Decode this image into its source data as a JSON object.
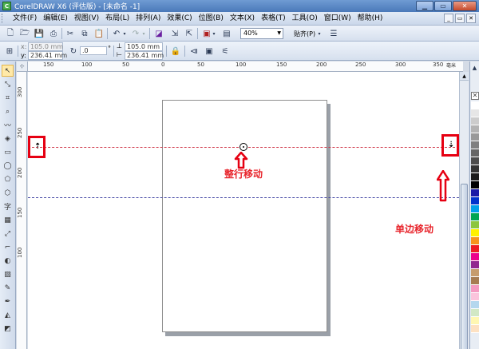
{
  "window": {
    "title": "CorelDRAW X6 (评估版) - [未命名 -1]",
    "app_icon": "coreldraw-icon",
    "controls": [
      "minimize",
      "maximize",
      "close"
    ]
  },
  "menu": {
    "items": [
      "文件(F)",
      "编辑(E)",
      "视图(V)",
      "布局(L)",
      "排列(A)",
      "效果(C)",
      "位图(B)",
      "文本(X)",
      "表格(T)",
      "工具(O)",
      "窗口(W)",
      "帮助(H)"
    ]
  },
  "standard_toolbar": {
    "zoom_value": "40%",
    "snap_label": "贴齐(P)"
  },
  "property_bar": {
    "x_label": "x:",
    "x_value": "105.0 mm",
    "y_label": "y:",
    "y_value": "236.41 mm",
    "angle_value": ".0",
    "pos_x_value": "105.0 mm",
    "pos_y_value": "236.41 mm"
  },
  "rulers": {
    "horizontal_ticks": [
      "150",
      "100",
      "50",
      "0",
      "50",
      "100",
      "150",
      "200",
      "250",
      "300",
      "350"
    ],
    "vertical_ticks": [
      "300",
      "250",
      "200",
      "150",
      "100"
    ],
    "units": "毫米"
  },
  "annotations": {
    "whole_row_move": "整行移动",
    "single_side_move": "单边移动"
  },
  "palette": {
    "colors": [
      "#ffffff",
      "#e6e6e6",
      "#cccccc",
      "#b3b3b3",
      "#999999",
      "#808080",
      "#666666",
      "#4d4d4d",
      "#333333",
      "#1a1a1a",
      "#000000",
      "#1a1aa6",
      "#0033cc",
      "#00a0e9",
      "#00a651",
      "#8dc63f",
      "#fff200",
      "#f7941d",
      "#ed1c24",
      "#ec008c",
      "#92278f",
      "#c69c6d",
      "#a67c52",
      "#f49ac1",
      "#fbc4dc",
      "#b4d7ee",
      "#d1e8c5",
      "#fff7b2",
      "#fde1c2"
    ]
  }
}
